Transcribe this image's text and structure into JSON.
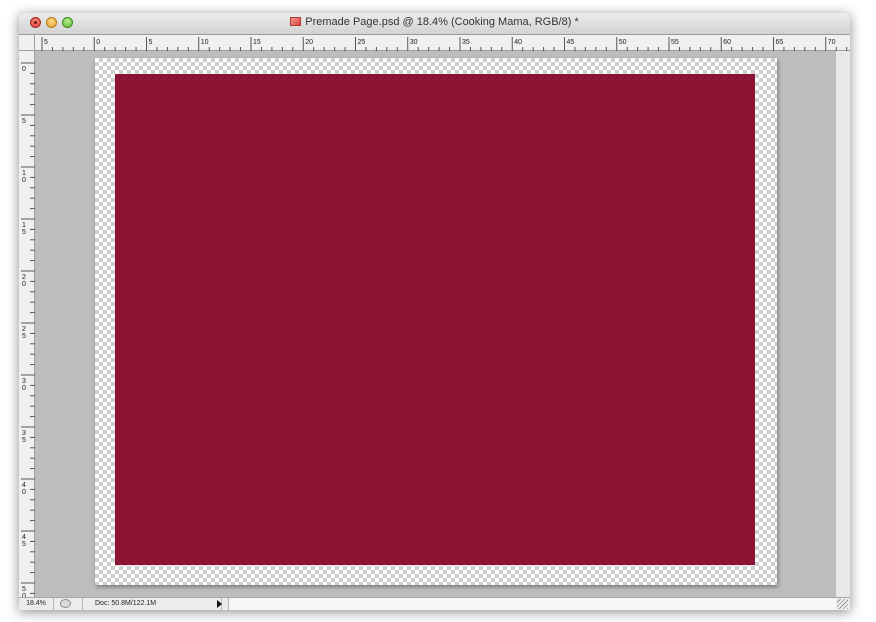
{
  "window": {
    "title": "Premade Page.psd @ 18.4% (Cooking  Mama, RGB/8) *"
  },
  "rulers": {
    "top_labels": [
      "5",
      "0",
      "5",
      "10",
      "15",
      "20",
      "25",
      "30",
      "35",
      "40",
      "45",
      "50",
      "55",
      "60",
      "65",
      "70"
    ],
    "left_labels": [
      "0",
      "5",
      "10",
      "15",
      "20",
      "25",
      "30",
      "35",
      "40",
      "45",
      "50"
    ]
  },
  "document": {
    "fill_color": "#8c1536"
  },
  "statusbar": {
    "zoom": "18.4%",
    "doc_size": "Doc: 50.8M/122.1M"
  },
  "icons": {
    "close": "close-button-icon",
    "minimize": "minimize-button-icon",
    "zoom": "zoom-button-icon",
    "document": "psd-document-icon",
    "status_menu": "triangle-right-icon"
  }
}
